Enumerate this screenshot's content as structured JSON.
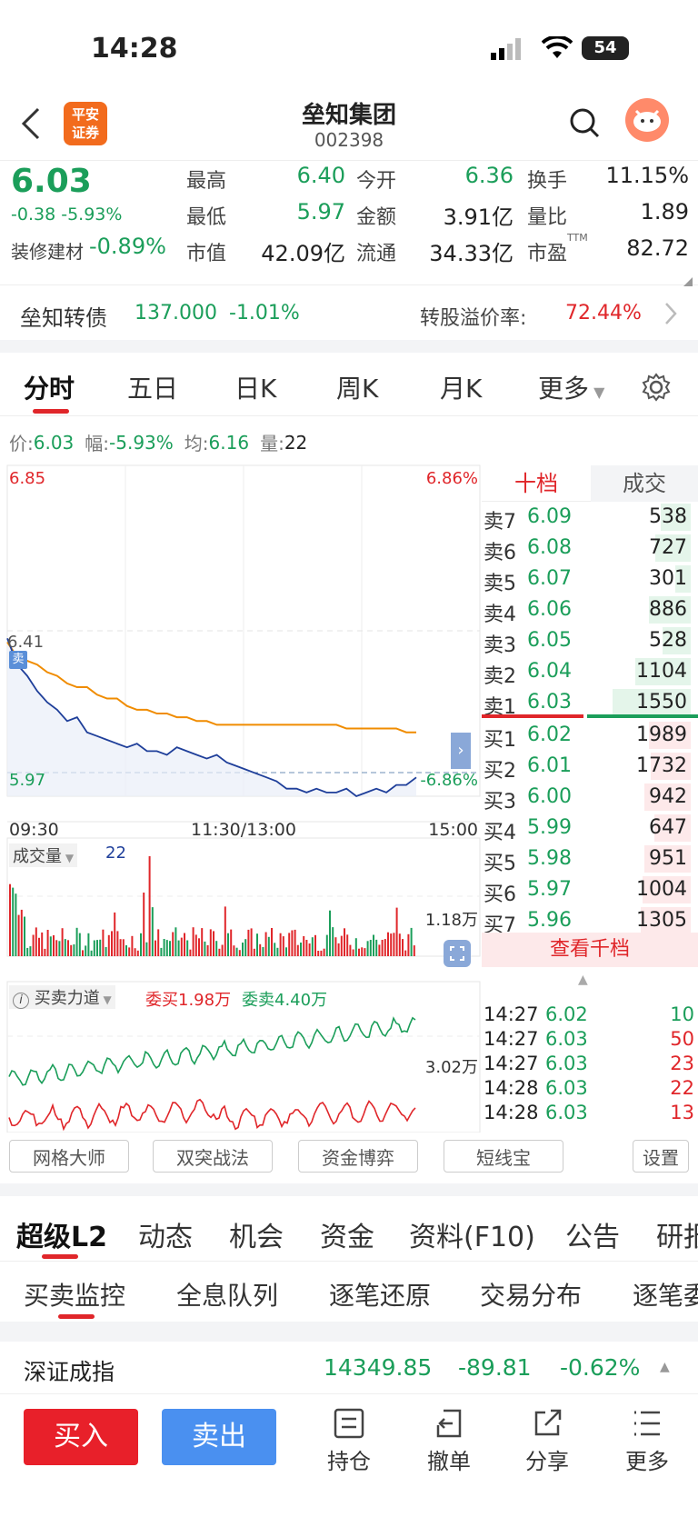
{
  "status_bar": {
    "time": "14:28",
    "battery": "54"
  },
  "header": {
    "title": "垒知集团",
    "code": "002398",
    "broker_logo_line1": "平安",
    "broker_logo_line2": "证券"
  },
  "quote": {
    "price": "6.03",
    "change": "-0.38",
    "change_pct": "-5.93%",
    "sector_name": "装修建材",
    "sector_pct": "-0.89%",
    "stats": [
      {
        "label": "最高",
        "value": "6.40"
      },
      {
        "label": "今开",
        "value": "6.36"
      },
      {
        "label": "换手",
        "value": "11.15%"
      },
      {
        "label": "最低",
        "value": "5.97"
      },
      {
        "label": "金额",
        "value": "3.91亿"
      },
      {
        "label": "量比",
        "value": "1.89"
      },
      {
        "label": "市值",
        "value": "42.09亿"
      },
      {
        "label": "流通",
        "value": "34.33亿"
      },
      {
        "label": "市盈",
        "value": "82.72",
        "sup": "TTM"
      }
    ]
  },
  "bond": {
    "name": "垒知转债",
    "price": "137.000",
    "pct": "-1.01%",
    "premium_label": "转股溢价率:",
    "premium_value": "72.44%"
  },
  "chart_tabs": [
    "分时",
    "五日",
    "日K",
    "周K",
    "月K",
    "更多"
  ],
  "price_bar": {
    "price_label": "价:",
    "price": "6.03",
    "amp_label": "幅:",
    "amp": "-5.93%",
    "avg_label": "均:",
    "avg": "6.16",
    "vol_label": "量:",
    "vol": "22"
  },
  "chart": {
    "top_price": "6.85",
    "top_pct": "6.86%",
    "mid_price": "6.41",
    "bottom_price": "5.97",
    "bottom_pct": "-6.86%",
    "time_start": "09:30",
    "time_mid": "11:30/13:00",
    "time_end": "15:00",
    "sell_marker": "卖",
    "volume_label": "成交量",
    "volume_value": "22",
    "volume_axis": "1.18万",
    "force_label": "买卖力道",
    "force_buy": "委买1.98万",
    "force_sell": "委卖4.40万",
    "force_axis": "3.02万"
  },
  "chart_data": {
    "type": "line",
    "ylim": [
      5.97,
      6.85
    ],
    "series": [
      {
        "values": [
          6.38,
          6.34,
          6.33,
          6.32,
          6.3,
          6.29,
          6.27,
          6.26,
          6.26,
          6.24,
          6.23,
          6.23,
          6.21,
          6.2,
          6.2,
          6.19,
          6.19,
          6.18,
          6.18,
          6.17,
          6.17,
          6.16,
          6.16,
          6.16,
          6.16,
          6.16,
          6.16,
          6.16,
          6.16,
          6.16,
          6.16,
          6.16,
          6.16,
          6.16,
          6.15,
          6.15,
          6.15,
          6.15,
          6.15,
          6.15,
          6.14,
          6.14
        ]
      },
      {
        "values": [
          6.39,
          6.32,
          6.29,
          6.25,
          6.22,
          6.2,
          6.17,
          6.18,
          6.14,
          6.13,
          6.12,
          6.11,
          6.1,
          6.11,
          6.09,
          6.09,
          6.08,
          6.1,
          6.09,
          6.08,
          6.07,
          6.08,
          6.06,
          6.05,
          6.04,
          6.03,
          6.02,
          6.01,
          5.99,
          5.99,
          5.98,
          5.99,
          5.98,
          5.98,
          5.99,
          5.97,
          5.98,
          5.99,
          5.98,
          6.0,
          6.0,
          6.02
        ]
      }
    ]
  },
  "order_book": {
    "tab_active": "十档",
    "tab_other": "成交",
    "asks": [
      {
        "label": "卖7",
        "price": "6.09",
        "vol": "538",
        "ratio": 0.3
      },
      {
        "label": "卖6",
        "price": "6.08",
        "vol": "727",
        "ratio": 0.35
      },
      {
        "label": "卖5",
        "price": "6.07",
        "vol": "301",
        "ratio": 0.15
      },
      {
        "label": "卖4",
        "price": "6.06",
        "vol": "886",
        "ratio": 0.42
      },
      {
        "label": "卖3",
        "price": "6.05",
        "vol": "528",
        "ratio": 0.28
      },
      {
        "label": "卖2",
        "price": "6.04",
        "vol": "1104",
        "ratio": 0.55
      },
      {
        "label": "卖1",
        "price": "6.03",
        "vol": "1550",
        "ratio": 0.78
      }
    ],
    "bids": [
      {
        "label": "买1",
        "price": "6.02",
        "vol": "1989",
        "ratio": 0.42
      },
      {
        "label": "买2",
        "price": "6.01",
        "vol": "1732",
        "ratio": 0.4
      },
      {
        "label": "买3",
        "price": "6.00",
        "vol": "942",
        "ratio": 0.46
      },
      {
        "label": "买4",
        "price": "5.99",
        "vol": "647",
        "ratio": 0.36
      },
      {
        "label": "买5",
        "price": "5.98",
        "vol": "951",
        "ratio": 0.46
      },
      {
        "label": "买6",
        "price": "5.97",
        "vol": "1004",
        "ratio": 0.48
      },
      {
        "label": "买7",
        "price": "5.96",
        "vol": "1305",
        "ratio": 0.5
      }
    ],
    "view_more": "查看千档",
    "trades": [
      {
        "time": "14:27",
        "price": "6.02",
        "vol": "10",
        "price_color": "#1b9e5a",
        "vol_color": "#1b9e5a"
      },
      {
        "time": "14:27",
        "price": "6.03",
        "vol": "50",
        "price_color": "#1b9e5a",
        "vol_color": "#e0262a"
      },
      {
        "time": "14:27",
        "price": "6.03",
        "vol": "23",
        "price_color": "#1b9e5a",
        "vol_color": "#e0262a"
      },
      {
        "time": "14:28",
        "price": "6.03",
        "vol": "22",
        "price_color": "#1b9e5a",
        "vol_color": "#e0262a"
      },
      {
        "time": "14:28",
        "price": "6.03",
        "vol": "13",
        "price_color": "#1b9e5a",
        "vol_color": "#e0262a"
      }
    ]
  },
  "tools": [
    "网格大师",
    "双突战法",
    "资金博弈",
    "短线宝",
    "设置"
  ],
  "main_tabs": [
    "超级L2",
    "动态",
    "机会",
    "资金",
    "资料(F10)",
    "公告",
    "研报"
  ],
  "sub_tabs": [
    "买卖监控",
    "全息队列",
    "逐笔还原",
    "交易分布",
    "逐笔委托"
  ],
  "index": {
    "name": "深证成指",
    "value": "14349.85",
    "change": "-89.81",
    "pct": "-0.62%"
  },
  "bottom": {
    "buy": "买入",
    "sell": "卖出",
    "nav": [
      "持仓",
      "撤单",
      "分享",
      "更多"
    ]
  },
  "colors": {
    "up": "#e0262a",
    "down": "#1b9e5a",
    "price_line": "#1f3f9a",
    "avg_line": "#f08c00",
    "buy_btn": "#e8202a",
    "sell_btn": "#4a90f0"
  }
}
